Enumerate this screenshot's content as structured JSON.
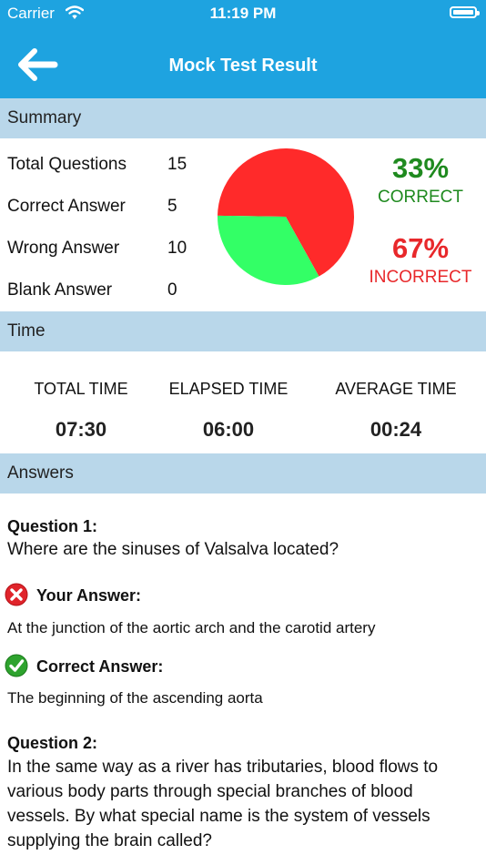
{
  "status": {
    "carrier": "Carrier",
    "time": "11:19 PM"
  },
  "header": {
    "title": "Mock Test Result"
  },
  "summary": {
    "heading": "Summary",
    "rows": [
      {
        "label": "Total Questions",
        "value": "15"
      },
      {
        "label": "Correct Answer",
        "value": "5"
      },
      {
        "label": "Wrong Answer",
        "value": "10"
      },
      {
        "label": "Blank Answer",
        "value": "0"
      }
    ],
    "correct_pct": "33%",
    "correct_label": "CORRECT",
    "incorrect_pct": "67%",
    "incorrect_label": "INCORRECT",
    "correct_fraction": 0.3333,
    "colors": {
      "correct": "#33ff66",
      "incorrect": "#ff2a2a",
      "correct_text": "#1f8a1f",
      "incorrect_text": "#e8282b",
      "accent": "#1ea3e0",
      "section_bg": "#b9d7ea"
    }
  },
  "time": {
    "heading": "Time",
    "items": [
      {
        "label": "TOTAL TIME",
        "value": "07:30"
      },
      {
        "label": "ELAPSED TIME",
        "value": "06:00"
      },
      {
        "label": "AVERAGE TIME",
        "value": "00:24"
      }
    ]
  },
  "answers": {
    "heading": "Answers",
    "questions": [
      {
        "title": "Question 1:",
        "text": "Where are the sinuses of Valsalva located?",
        "your_label": "Your Answer:",
        "your_answer": "At the junction of the aortic arch and the carotid artery",
        "correct_label": "Correct Answer:",
        "correct_answer": "The beginning of the ascending aorta"
      },
      {
        "title": "Question 2:",
        "text": "In the same way as a river has tributaries, blood flows to various body parts through special branches of blood vessels. By what special name is the system of vessels supplying the brain called?"
      }
    ]
  },
  "icons": {
    "back": "arrow-left-icon",
    "wrong": "x-circle-icon",
    "right": "check-circle-icon",
    "wifi": "wifi-icon",
    "battery": "battery-icon"
  }
}
